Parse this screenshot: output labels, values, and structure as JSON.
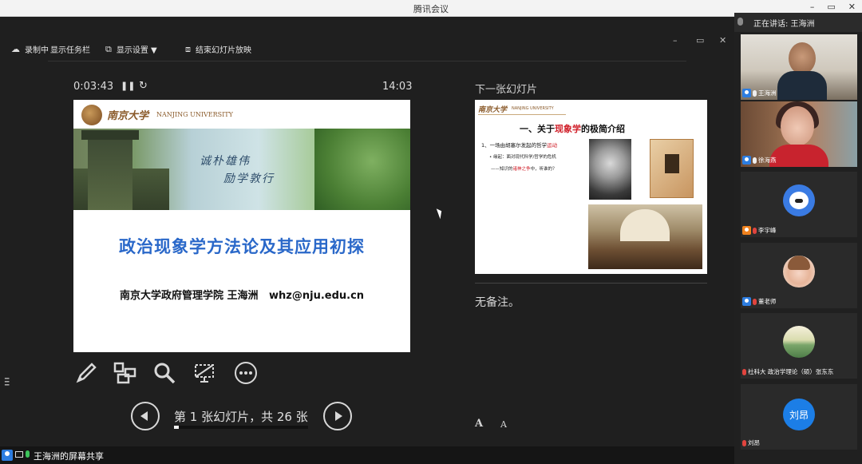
{
  "window": {
    "title": "腾讯会议",
    "controls": [
      "–",
      "▭",
      "✕"
    ]
  },
  "toolbar": {
    "record_hint": "录制中",
    "show_taskbar": "显示任务栏",
    "display_settings": "显示设置 ▼",
    "end_slideshow": "结束幻灯片放映",
    "minimize": "–",
    "restore": "▭",
    "close": "✕"
  },
  "presenter": {
    "elapsed": "0:03:43",
    "clock": "14:03",
    "current_slide": {
      "school_cn": "南京大学",
      "school_en": "NANJING UNIVERSITY",
      "motto_1": "诚朴雄伟",
      "motto_2": "励学敦行",
      "title": "政治现象学方法论及其应用初探",
      "subtitle": "南京大学政府管理学院 王海洲   whz@nju.edu.cn"
    },
    "navigation": {
      "label": "第 1 张幻灯片，共 26 张",
      "current": 1,
      "total": 26
    },
    "next_slide_label": "下一张幻灯片",
    "next_slide": {
      "school_cn": "南京大学",
      "school_en": "NANJING UNIVERSITY",
      "title_pre": "一、关于",
      "title_red": "现象学",
      "title_post": "的极简介绍",
      "bullet_1_pre": "1、一场由胡塞尔发起的哲学",
      "bullet_1_red": "运动",
      "bullet_2": "• 缘起：面对现代科学/哲学的危机",
      "bullet_3_pre": "——知识的",
      "bullet_3_red": "诸神之争",
      "bullet_3_post": "中，听谁的？"
    },
    "notes": "无备注。",
    "font_increase": "A",
    "font_decrease": "A"
  },
  "panel": {
    "speaking_label": "正在讲话: 王海洲",
    "participants": [
      {
        "name": "王海洲",
        "badge": "blue",
        "mic": "on"
      },
      {
        "name": "徐海燕",
        "badge": "blue",
        "mic": "on"
      },
      {
        "name": "李宇峰",
        "badge": "orange",
        "mic": "muted"
      },
      {
        "name": "董老师",
        "badge": "blue",
        "mic": "muted"
      },
      {
        "name": "社科大 政治学理论（硕）张东东",
        "badge": "none",
        "mic": "muted"
      },
      {
        "name": "刘昂",
        "badge": "none",
        "mic": "muted",
        "initials": "刘昂"
      }
    ]
  },
  "statusbar": {
    "label": "王海洲的屏幕共享"
  }
}
